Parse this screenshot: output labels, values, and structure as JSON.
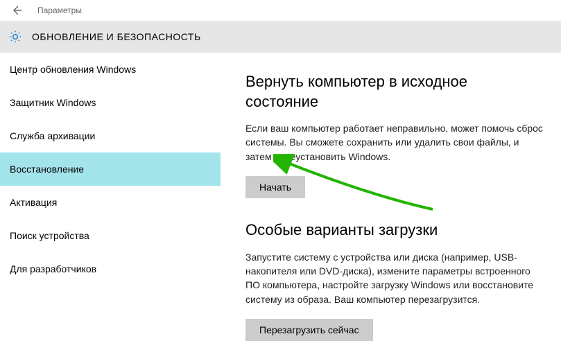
{
  "window": {
    "title": "Параметры"
  },
  "header": {
    "title": "ОБНОВЛЕНИЕ И БЕЗОПАСНОСТЬ"
  },
  "sidebar": {
    "items": [
      {
        "label": "Центр обновления Windows",
        "selected": false
      },
      {
        "label": "Защитник Windows",
        "selected": false
      },
      {
        "label": "Служба архивации",
        "selected": false
      },
      {
        "label": "Восстановление",
        "selected": true
      },
      {
        "label": "Активация",
        "selected": false
      },
      {
        "label": "Поиск устройства",
        "selected": false
      },
      {
        "label": "Для разработчиков",
        "selected": false
      }
    ]
  },
  "content": {
    "section1": {
      "title": "Вернуть компьютер в исходное состояние",
      "text": "Если ваш компьютер работает неправильно, может помочь сброс системы. Вы сможете сохранить или удалить свои файлы, и затем переустановить Windows.",
      "button": "Начать"
    },
    "section2": {
      "title": "Особые варианты загрузки",
      "text": "Запустите систему с устройства или диска (например, USB-накопителя или DVD-диска), измените параметры встроенного ПО компьютера, настройте загрузку Windows или восстановите систему из образа. Ваш компьютер перезагрузится.",
      "button": "Перезагрузить сейчас"
    }
  }
}
